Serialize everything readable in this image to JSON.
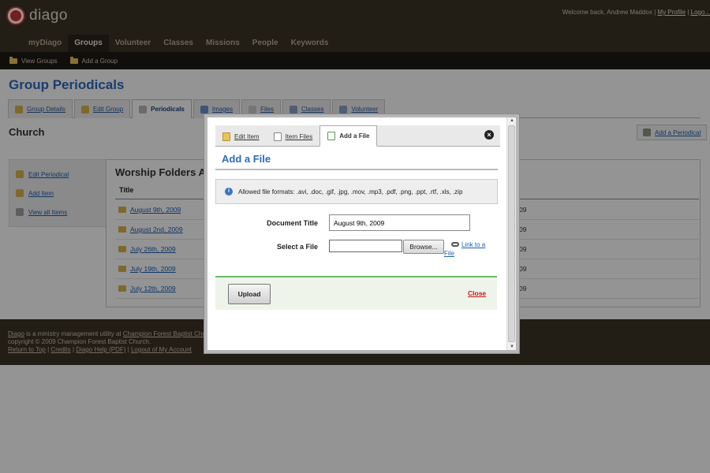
{
  "app": {
    "logo_text": "diago"
  },
  "header": {
    "welcome": "Welcome back, Andrew Maddox |",
    "profile_link": "My Profile",
    "separator": "|",
    "logout_link": "Logo..."
  },
  "nav": {
    "items": [
      "myDiago",
      "Groups",
      "Volunteer",
      "Classes",
      "Missions",
      "People",
      "Keywords"
    ],
    "active": "Groups"
  },
  "subnav": {
    "items": [
      "View Groups",
      "Add a Group"
    ]
  },
  "page": {
    "title": "Group Periodicals"
  },
  "tabs": {
    "items": [
      "Group Details",
      "Edit Group",
      "Periodicals",
      "Images",
      "Files",
      "Classes",
      "Volunteer"
    ],
    "active": "Periodicals"
  },
  "section": {
    "title": "Church",
    "add_button": "Add a Periodical"
  },
  "sidebar": {
    "items": [
      "Edit Periodical",
      "Add Item",
      "View all Items"
    ]
  },
  "list": {
    "title": "Worship Folders A",
    "column_title": "Title",
    "rows": [
      {
        "date": "August 9th, 2009",
        "right": "09"
      },
      {
        "date": "August 2nd, 2009",
        "right": "09"
      },
      {
        "date": "July 26th, 2009",
        "right": "09"
      },
      {
        "date": "July 19th, 2009",
        "right": "09"
      },
      {
        "date": "July 12th, 2009",
        "right": "09"
      }
    ]
  },
  "footer": {
    "line1_prefix": "Diago",
    "line1_text": " is a ministry management utility at ",
    "line1_link": "Champion Forest Baptist Chu...",
    "line2": "copyright © 2009 Champion Forest Baptist Church.",
    "links": [
      "Return to Top",
      "Credits",
      "Diago Help (PDF)",
      "Logout of My Account"
    ],
    "sep": " | "
  },
  "modal": {
    "tabs": [
      "Edit Item",
      "Item Files",
      "Add a File"
    ],
    "active_tab": "Add a File",
    "close_icon": "×",
    "title": "Add a File",
    "info_icon": "i",
    "info_text": "Allowed file formats: .avi, .doc, .gif, .jpg, .mov, .mp3, .pdf, .png, .ppt, .rtf, .xls, .zip",
    "doc_title_label": "Document Title",
    "doc_title_value": "August 9th, 2009",
    "select_file_label": "Select a File",
    "browse_label": "Browse...",
    "link_to_file": "Link to a File",
    "upload_label": "Upload",
    "close_label": "Close",
    "scroll_up": "▲",
    "scroll_down": "▼"
  }
}
